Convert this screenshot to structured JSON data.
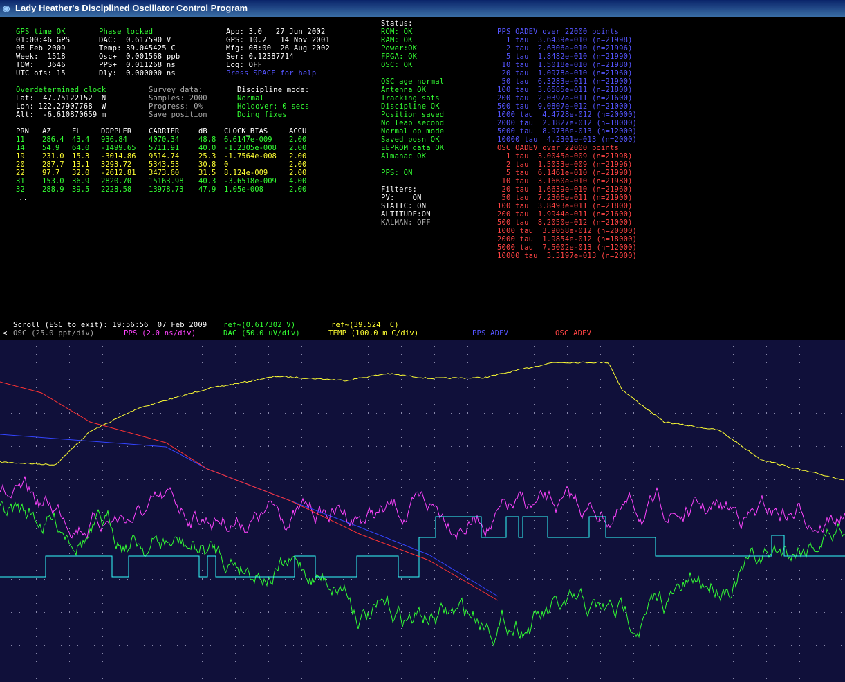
{
  "window": {
    "title": "Lady Heather's Disciplined Oscillator Control Program"
  },
  "gps": {
    "status": "GPS time OK",
    "time": "01:00:46 GPS",
    "date": "08 Feb 2009",
    "week": "Week:  1518",
    "tow": "TOW:   3646",
    "utc": "UTC ofs: 15"
  },
  "osc": {
    "phase": "Phase locked",
    "dac": "DAC:  0.617590 V",
    "temp": "Temp: 39.045425 C",
    "osc": "Osc+  0.001568 ppb",
    "pps": "PPS+  0.011268 ns",
    "dly": "Dly:  0.000000 ns"
  },
  "info": {
    "app": "App: 3.0   27 Jun 2002",
    "gps": "GPS: 10.2   14 Nov 2001",
    "mfg": "Mfg: 08:00  26 Aug 2002",
    "ser": "Ser: 0.12387714",
    "log": "Log: OFF",
    "help": "Press SPACE for help"
  },
  "position": {
    "clock": "Overdetermined clock",
    "lat": "Lat:  47.75122152  N",
    "lon": "Lon: 122.27907768  W",
    "alt": "Alt:  -6.610870659 m"
  },
  "survey": {
    "title": "Survey data:",
    "samples": "Samples: 2000",
    "progress": "Progress: 0%",
    "save": "Save position"
  },
  "discipline": {
    "title": "Discipline mode:",
    "mode": "Normal",
    "holdover": "Holdover: 0 secs",
    "fixes": "Doing fixes"
  },
  "sat_table": {
    "headers": [
      "PRN",
      "AZ",
      "EL",
      "DOPPLER",
      "CARRIER",
      "dB",
      "CLOCK_BIAS",
      "ACCU"
    ],
    "rows": [
      {
        "prn": "11",
        "az": "286.4",
        "el": "43.4",
        "doppler": "936.84",
        "carrier": "4070.34",
        "db": "48.8",
        "bias": "6.6147e-009",
        "accu": "2.00",
        "color": "#33ff33"
      },
      {
        "prn": "14",
        "az": "54.9",
        "el": "64.0",
        "doppler": "-1499.65",
        "carrier": "5711.91",
        "db": "40.0",
        "bias": "-1.2305e-008",
        "accu": "2.00",
        "color": "#33ff33"
      },
      {
        "prn": "19",
        "az": "231.0",
        "el": "15.3",
        "doppler": "-3014.86",
        "carrier": "9514.74",
        "db": "25.3",
        "bias": "-1.7564e-008",
        "accu": "2.00",
        "color": "#ffff33"
      },
      {
        "prn": "20",
        "az": "287.7",
        "el": "13.1",
        "doppler": "3293.72",
        "carrier": "5343.53",
        "db": "30.8",
        "bias": "0",
        "accu": "2.00",
        "color": "#ffff33"
      },
      {
        "prn": "22",
        "az": "97.7",
        "el": "32.0",
        "doppler": "-2612.81",
        "carrier": "3473.60",
        "db": "31.5",
        "bias": "8.124e-009",
        "accu": "2.00",
        "color": "#ffff33"
      },
      {
        "prn": "31",
        "az": "153.0",
        "el": "36.9",
        "doppler": "2820.70",
        "carrier": "15163.98",
        "db": "40.3",
        "bias": "-3.6518e-009",
        "accu": "4.00",
        "color": "#33ff33"
      },
      {
        "prn": "32",
        "az": "288.9",
        "el": "39.5",
        "doppler": "2228.58",
        "carrier": "13978.73",
        "db": "47.9",
        "bias": "1.05e-008",
        "accu": "2.00",
        "color": "#33ff33"
      }
    ],
    "more": ".."
  },
  "status": {
    "title": "Status:",
    "rom": "ROM: OK",
    "ram": "RAM: OK",
    "power": "Power:OK",
    "fpga": "FPGA: OK",
    "osc": "OSC: OK",
    "age": "OSC age normal",
    "antenna": "Antenna OK",
    "tracking": "Tracking sats",
    "discipline": "Discipline OK",
    "pos_saved": "Position saved",
    "leap": "No leap second",
    "normal": "Normal op mode",
    "saved_posn": "Saved posn OK",
    "eeprom": "EEPROM data OK",
    "almanac": "Almanac OK",
    "pps": "PPS: ON"
  },
  "filters": {
    "title": "Filters:",
    "pv": "PV:    ON",
    "static": "STATIC: ON",
    "altitude": "ALTITUDE:ON",
    "kalman": "KALMAN: OFF"
  },
  "pps_adev": {
    "title": "PPS OADEV over 22000 points",
    "rows": [
      "  1 tau  3.6439e-010 (n=21998)",
      "  2 tau  2.6306e-010 (n=21996)",
      "  5 tau  1.8482e-010 (n=21990)",
      " 10 tau  1.5018e-010 (n=21980)",
      " 20 tau  1.0978e-010 (n=21960)",
      " 50 tau  6.3283e-011 (n=21900)",
      "100 tau  3.6585e-011 (n=21800)",
      "200 tau  2.0397e-011 (n=21600)",
      "500 tau  9.0807e-012 (n=21000)",
      "1000 tau  4.4728e-012 (n=20000)",
      "2000 tau  2.1827e-012 (n=18000)",
      "5000 tau  8.9736e-013 (n=12000)",
      "10000 tau  4.2301e-013 (n=2000)"
    ]
  },
  "osc_adev": {
    "title": "OSC OADEV over 22000 points",
    "rows": [
      "  1 tau  3.0045e-009 (n=21998)",
      "  2 tau  1.5033e-009 (n=21996)",
      "  5 tau  6.1461e-010 (n=21990)",
      " 10 tau  3.1660e-010 (n=21980)",
      " 20 tau  1.6639e-010 (n=21960)",
      " 50 tau  7.2306e-011 (n=21900)",
      "100 tau  3.8493e-011 (n=21800)",
      "200 tau  1.9944e-011 (n=21600)",
      "500 tau  8.2050e-012 (n=21000)",
      "1000 tau  3.9058e-012 (n=20000)",
      "2000 tau  1.9854e-012 (n=18000)",
      "5000 tau  7.5002e-013 (n=12000)",
      "10000 tau  3.3197e-013 (n=2000)"
    ]
  },
  "plot_header": {
    "scroll": "Scroll (ESC to exit): 19:56:56  07 Feb 2009",
    "ref_dac": "ref~(0.617302 V)",
    "ref_temp": "ref~(39.524  C)",
    "arrow": "<",
    "osc": "OSC (25.0 ppt/div)",
    "pps": "PPS (2.0 ns/div)",
    "dac": "DAC (50.0 uV/div)",
    "temp": "TEMP (100.0 m C/div)",
    "pps_adev": "PPS ADEV",
    "osc_adev": "OSC ADEV"
  },
  "colors": {
    "background": "#000000",
    "plot_bg": "#10103a",
    "grid_dots": "#8888aa",
    "temp": "#ffff33",
    "pps": "#ff44ff",
    "dac": "#33ff33",
    "osc": "#33ffff",
    "pps_adev": "#3344ff",
    "osc_adev": "#ff3333"
  }
}
